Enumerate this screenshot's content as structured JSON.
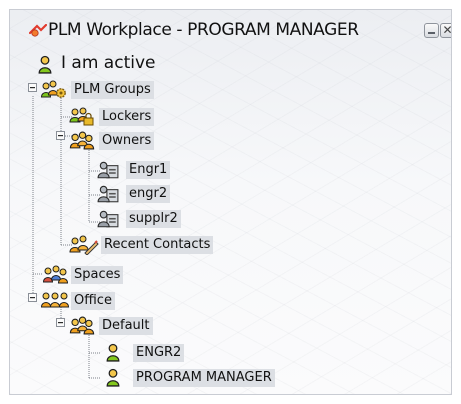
{
  "window": {
    "title": "PLM Workplace - PROGRAM MANAGER",
    "close_glyph": "✕"
  },
  "status": {
    "text": "I am active",
    "icon": "person-icon"
  },
  "tree": {
    "plm_groups": {
      "label": "PLM Groups",
      "icon": "group-settings-icon"
    },
    "lockers": {
      "label": "Lockers",
      "icon": "lockers-icon"
    },
    "owners": {
      "label": "Owners",
      "icon": "group-icon"
    },
    "engr1": {
      "label": "Engr1",
      "icon": "contact-card-icon"
    },
    "engr2_lower": {
      "label": "engr2",
      "icon": "contact-card-icon"
    },
    "supplr2": {
      "label": "supplr2",
      "icon": "contact-card-icon"
    },
    "recent_contacts": {
      "label": "Recent Contacts",
      "icon": "recent-contacts-icon"
    },
    "spaces": {
      "label": "Spaces",
      "icon": "spaces-icon"
    },
    "office": {
      "label": "Office",
      "icon": "office-group-icon"
    },
    "default": {
      "label": "Default",
      "icon": "group-icon"
    },
    "engr2_upper": {
      "label": "ENGR2",
      "icon": "person-icon"
    },
    "program_manager": {
      "label": "PROGRAM MANAGER",
      "icon": "person-icon"
    }
  },
  "colors": {
    "person_green": "#7cc41c",
    "person_yellow": "#e8b92a",
    "group_orange": "#f0a01e",
    "tree_line": "#7d828a",
    "label_bg": "#dcdfe4"
  }
}
